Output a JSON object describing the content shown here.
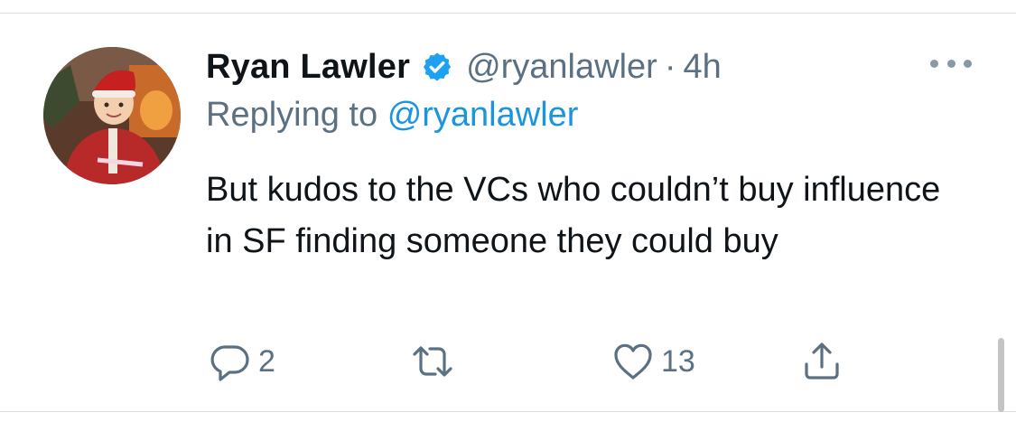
{
  "tweet": {
    "author_name": "Ryan Lawler",
    "author_handle": "@ryanlawler",
    "separator": "·",
    "timestamp": "4h",
    "replying_prefix": "Replying to",
    "replying_handle": "@ryanlawler",
    "text": "But kudos to the VCs who couldn’t buy influence in SF finding someone they could buy",
    "reply_count": "2",
    "like_count": "13"
  },
  "icons": {
    "verified": "verified-badge-icon",
    "more": "more-options-icon",
    "reply": "reply-icon",
    "retweet": "retweet-icon",
    "like": "like-heart-icon",
    "share": "share-icon"
  },
  "colors": {
    "text_primary": "#0f1419",
    "text_secondary": "#5b7083",
    "link": "#1b95e0",
    "verified_badge": "#1da1f2",
    "divider": "#d9dde0"
  }
}
